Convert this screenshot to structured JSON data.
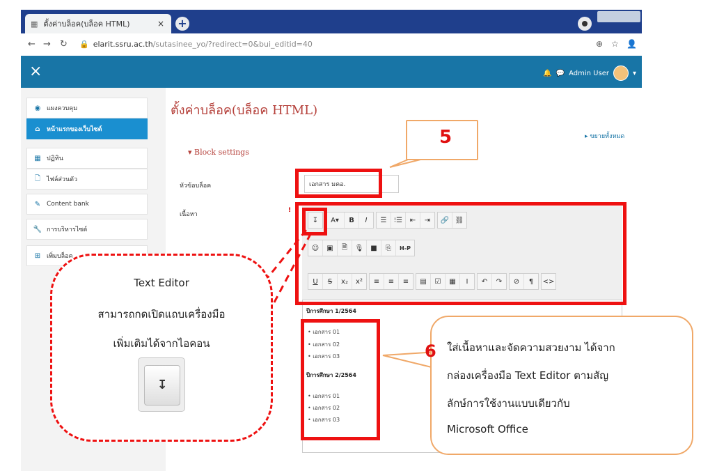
{
  "browser": {
    "tab_title": "ตั้งค่าบล็อค(บล็อค HTML)",
    "tab_close": "×",
    "new_tab": "+",
    "url_host": "elarit.ssru.ac.th",
    "url_path": "/sutasinee_yo/?redirect=0&bui_editid=40"
  },
  "header": {
    "close": "×",
    "user_name": "Admin User"
  },
  "sidebar": {
    "items": [
      {
        "label": "แผงควบคุม",
        "icon": "dashboard-icon"
      },
      {
        "label": "หน้าแรกของเว็บไซต์",
        "icon": "home-icon"
      },
      {
        "label": "ปฏิทิน",
        "icon": "calendar-icon"
      },
      {
        "label": "ไฟล์ส่วนตัว",
        "icon": "file-icon"
      },
      {
        "label": "Content bank",
        "icon": "pencil-icon"
      },
      {
        "label": "การบริหารไซต์",
        "icon": "wrench-icon"
      },
      {
        "label": "เพิ่มบล็อค",
        "icon": "plus-icon"
      }
    ]
  },
  "page": {
    "title": "ตั้งค่าบล็อค(บล็อค HTML)",
    "expand_all": "▸ ขยายทั้งหมด",
    "block_settings": "▾ Block settings",
    "block_title_label": "หัวข้อบล็อค",
    "block_title_value": "เอกสาร มคอ.",
    "content_label": "เนื้อหา",
    "required_mark": "!"
  },
  "toolbar": {
    "row1": [
      "↧",
      "A▾",
      "B",
      "I",
      "☰",
      "⁝☰",
      "⇤",
      "⇥",
      "🔗",
      "⛓"
    ],
    "row2": [
      "☺",
      "▣",
      "🗎",
      "🎙",
      "■",
      "⎘",
      "H-P"
    ],
    "row3": [
      "U",
      "S",
      "x₂",
      "x²",
      "≡",
      "≡",
      "≡",
      "▤",
      "☑",
      "▦",
      "I",
      "↶",
      "↷",
      "⊘",
      "¶",
      "<>"
    ]
  },
  "editor": {
    "year1": "ปีการศึกษา 1/2564",
    "year2": "ปีการศึกษา 2/2564",
    "docs": [
      "เอกสาร 01",
      "เอกสาร 02",
      "เอกสาร 03"
    ]
  },
  "callout5": {
    "number": "5"
  },
  "callout6": {
    "number": "6",
    "lines": [
      "ใส่เนื้อหาและจัดความสวยงาม ได้จาก",
      "กล่องเครื่องมือ Text Editor ตามสัญ",
      "ลักษ์การใช้งานแบบเดียวกับ",
      "Microsoft Office"
    ]
  },
  "bubble": {
    "lines": [
      "Text Editor",
      "สามารถกดเปิดแถบเครื่องมือ",
      "เพิ่มเติมได้จากไอคอน"
    ],
    "icon_glyph": "↧"
  },
  "colors": {
    "header_bg": "#1875a6",
    "active_nav": "#1a8fd0",
    "title_red": "#b5403a",
    "annotation_red": "#ee1111",
    "callout_border": "#f0a868"
  }
}
